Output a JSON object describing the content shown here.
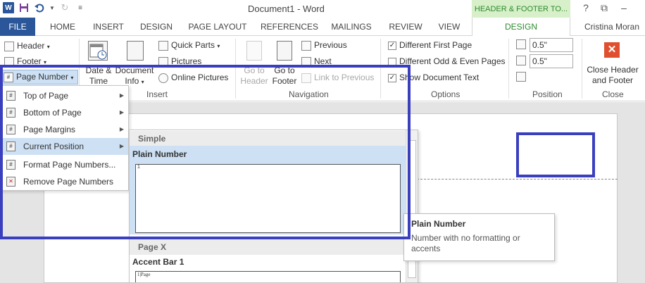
{
  "titlebar": {
    "app_logo": "W",
    "doc_title": "Document1 - Word",
    "contextual_tab": "HEADER & FOOTER TO...",
    "help": "?",
    "restore": "⧉",
    "minimize": "–"
  },
  "tabs": {
    "file": "FILE",
    "home": "HOME",
    "insert": "INSERT",
    "design": "DESIGN",
    "page_layout": "PAGE LAYOUT",
    "references": "REFERENCES",
    "mailings": "MAILINGS",
    "review": "REVIEW",
    "view": "VIEW",
    "hf_design": "DESIGN",
    "user": "Cristina Moran"
  },
  "ribbon": {
    "header": "Header",
    "footer": "Footer",
    "page_number": "Page Number",
    "date_time_1": "Date &",
    "date_time_2": "Time",
    "doc_info_1": "Document",
    "doc_info_2": "Info",
    "quick_parts": "Quick Parts",
    "pictures": "Pictures",
    "online_pictures": "Online Pictures",
    "insert_label": "Insert",
    "goto_header_1": "Go to",
    "goto_header_2": "Header",
    "goto_footer_1": "Go to",
    "goto_footer_2": "Footer",
    "previous": "Previous",
    "next": "Next",
    "link_previous": "Link to Previous",
    "navigation_label": "Navigation",
    "diff_first": "Different First Page",
    "diff_odd_even": "Different Odd & Even Pages",
    "show_doc_text": "Show Document Text",
    "options_label": "Options",
    "header_pos": "0.5\"",
    "footer_pos": "0.5\"",
    "position_label": "Position",
    "close_1": "Close Header",
    "close_2": "and Footer",
    "close_label": "Close"
  },
  "menu": {
    "items": [
      {
        "label": "Top of Page",
        "submenu": true
      },
      {
        "label": "Bottom of Page",
        "submenu": true
      },
      {
        "label": "Page Margins",
        "submenu": true
      },
      {
        "label": "Current Position",
        "submenu": true,
        "highlighted": true
      },
      {
        "label": "Format Page Numbers...",
        "submenu": false
      },
      {
        "label": "Remove Page Numbers",
        "submenu": false
      }
    ]
  },
  "gallery": {
    "section1": "Simple",
    "item1": "Plain Number",
    "item1_preview": "1",
    "section2": "Page X",
    "item2": "Accent Bar 1",
    "item2_preview": "1|Page"
  },
  "tooltip": {
    "title": "Plain Number",
    "desc": "Number with no formatting or accents"
  }
}
